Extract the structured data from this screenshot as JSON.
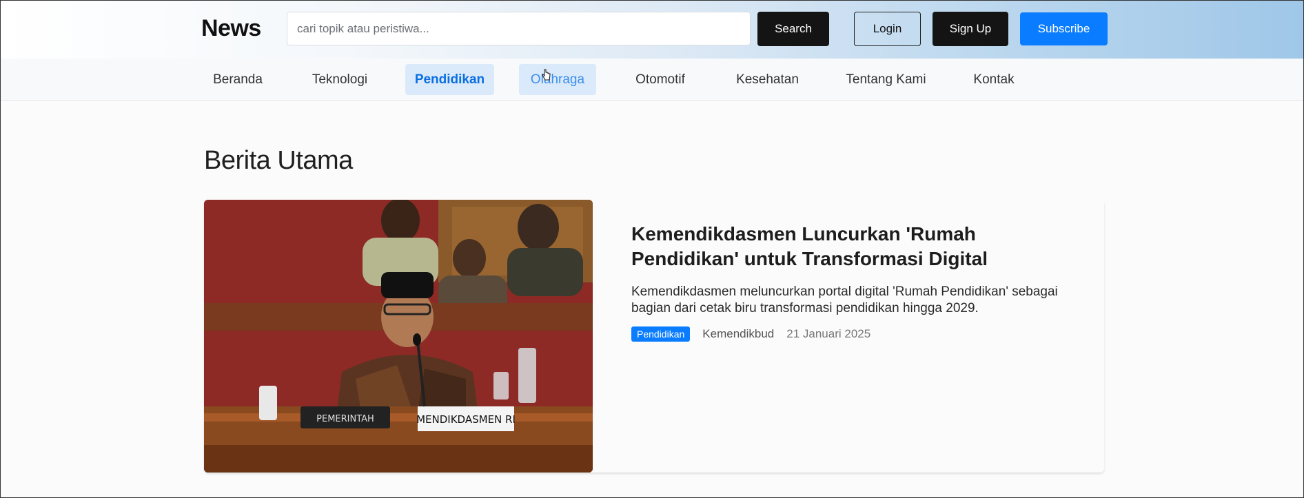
{
  "header": {
    "logo": "News",
    "search_placeholder": "cari topik atau peristiwa...",
    "search_label": "Search",
    "login_label": "Login",
    "signup_label": "Sign Up",
    "subscribe_label": "Subscribe"
  },
  "nav": {
    "items": [
      {
        "label": "Beranda"
      },
      {
        "label": "Teknologi"
      },
      {
        "label": "Pendidikan"
      },
      {
        "label": "Olahraga"
      },
      {
        "label": "Otomotif"
      },
      {
        "label": "Kesehatan"
      },
      {
        "label": "Tentang Kami"
      },
      {
        "label": "Kontak"
      }
    ],
    "active": "Pendidikan",
    "hovered": "Olahraga"
  },
  "main": {
    "section_title": "Berita Utama",
    "featured": {
      "headline": "Kemendikdasmen Luncurkan 'Rumah Pendidikan' untuk Transformasi Digital",
      "summary": "Kemendikdasmen meluncurkan portal digital 'Rumah Pendidikan' sebagai bagian dari cetak biru transformasi pendidikan hingga 2029.",
      "category": "Pendidikan",
      "source": "Kemendikbud",
      "date": "21 Januari 2025",
      "image_sign_1": "PEMERINTAH",
      "image_sign_2": "MENDIKDASMEN RI"
    }
  },
  "colors": {
    "accent": "#0a7cff",
    "dark_button": "#141414",
    "nav_active_bg": "#dbeafb",
    "nav_active_text": "#0b6fe0"
  }
}
